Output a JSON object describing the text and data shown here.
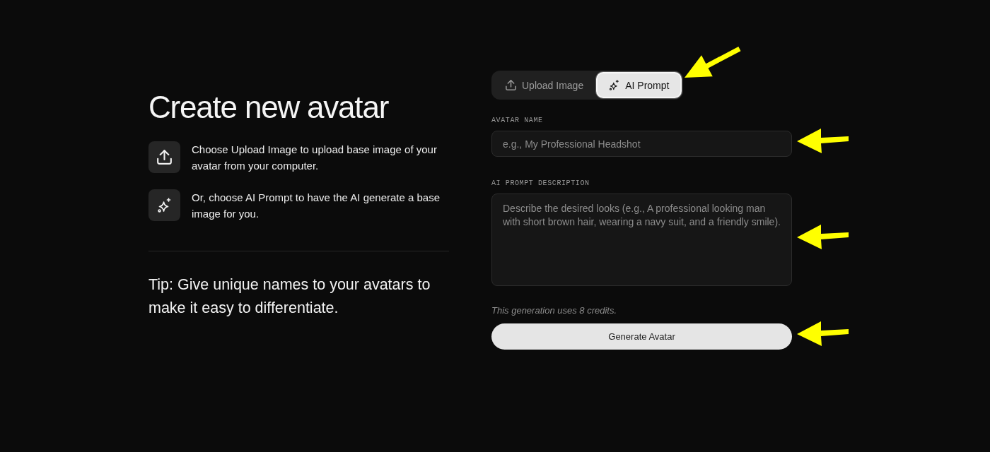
{
  "intro": {
    "title": "Create new avatar",
    "features": [
      {
        "kind": "upload",
        "text": "Choose Upload Image to upload base image of your avatar from your computer."
      },
      {
        "kind": "sparkle",
        "text": "Or, choose AI Prompt to have the AI generate a base image for you."
      }
    ],
    "tip": "Tip: Give unique names to your avatars to make it easy to differentiate."
  },
  "form": {
    "tabs": [
      {
        "kind": "upload",
        "label": "Upload Image",
        "selected": false
      },
      {
        "kind": "sparkle",
        "label": "AI Prompt",
        "selected": true
      }
    ],
    "tabs_annotated": true,
    "fields": [
      {
        "kind": "input",
        "label": "AVATAR NAME",
        "placeholder": "e.g., My Professional Headshot",
        "annotated": true
      },
      {
        "kind": "textarea",
        "label": "AI PROMPT DESCRIPTION",
        "placeholder": "Describe the desired looks (e.g., A professional looking man with short brown hair, wearing a navy suit, and a friendly smile).",
        "annotated": true
      }
    ],
    "credits_note": "This generation uses 8 credits.",
    "submit": {
      "label": "Generate Avatar",
      "annotated": true
    }
  }
}
